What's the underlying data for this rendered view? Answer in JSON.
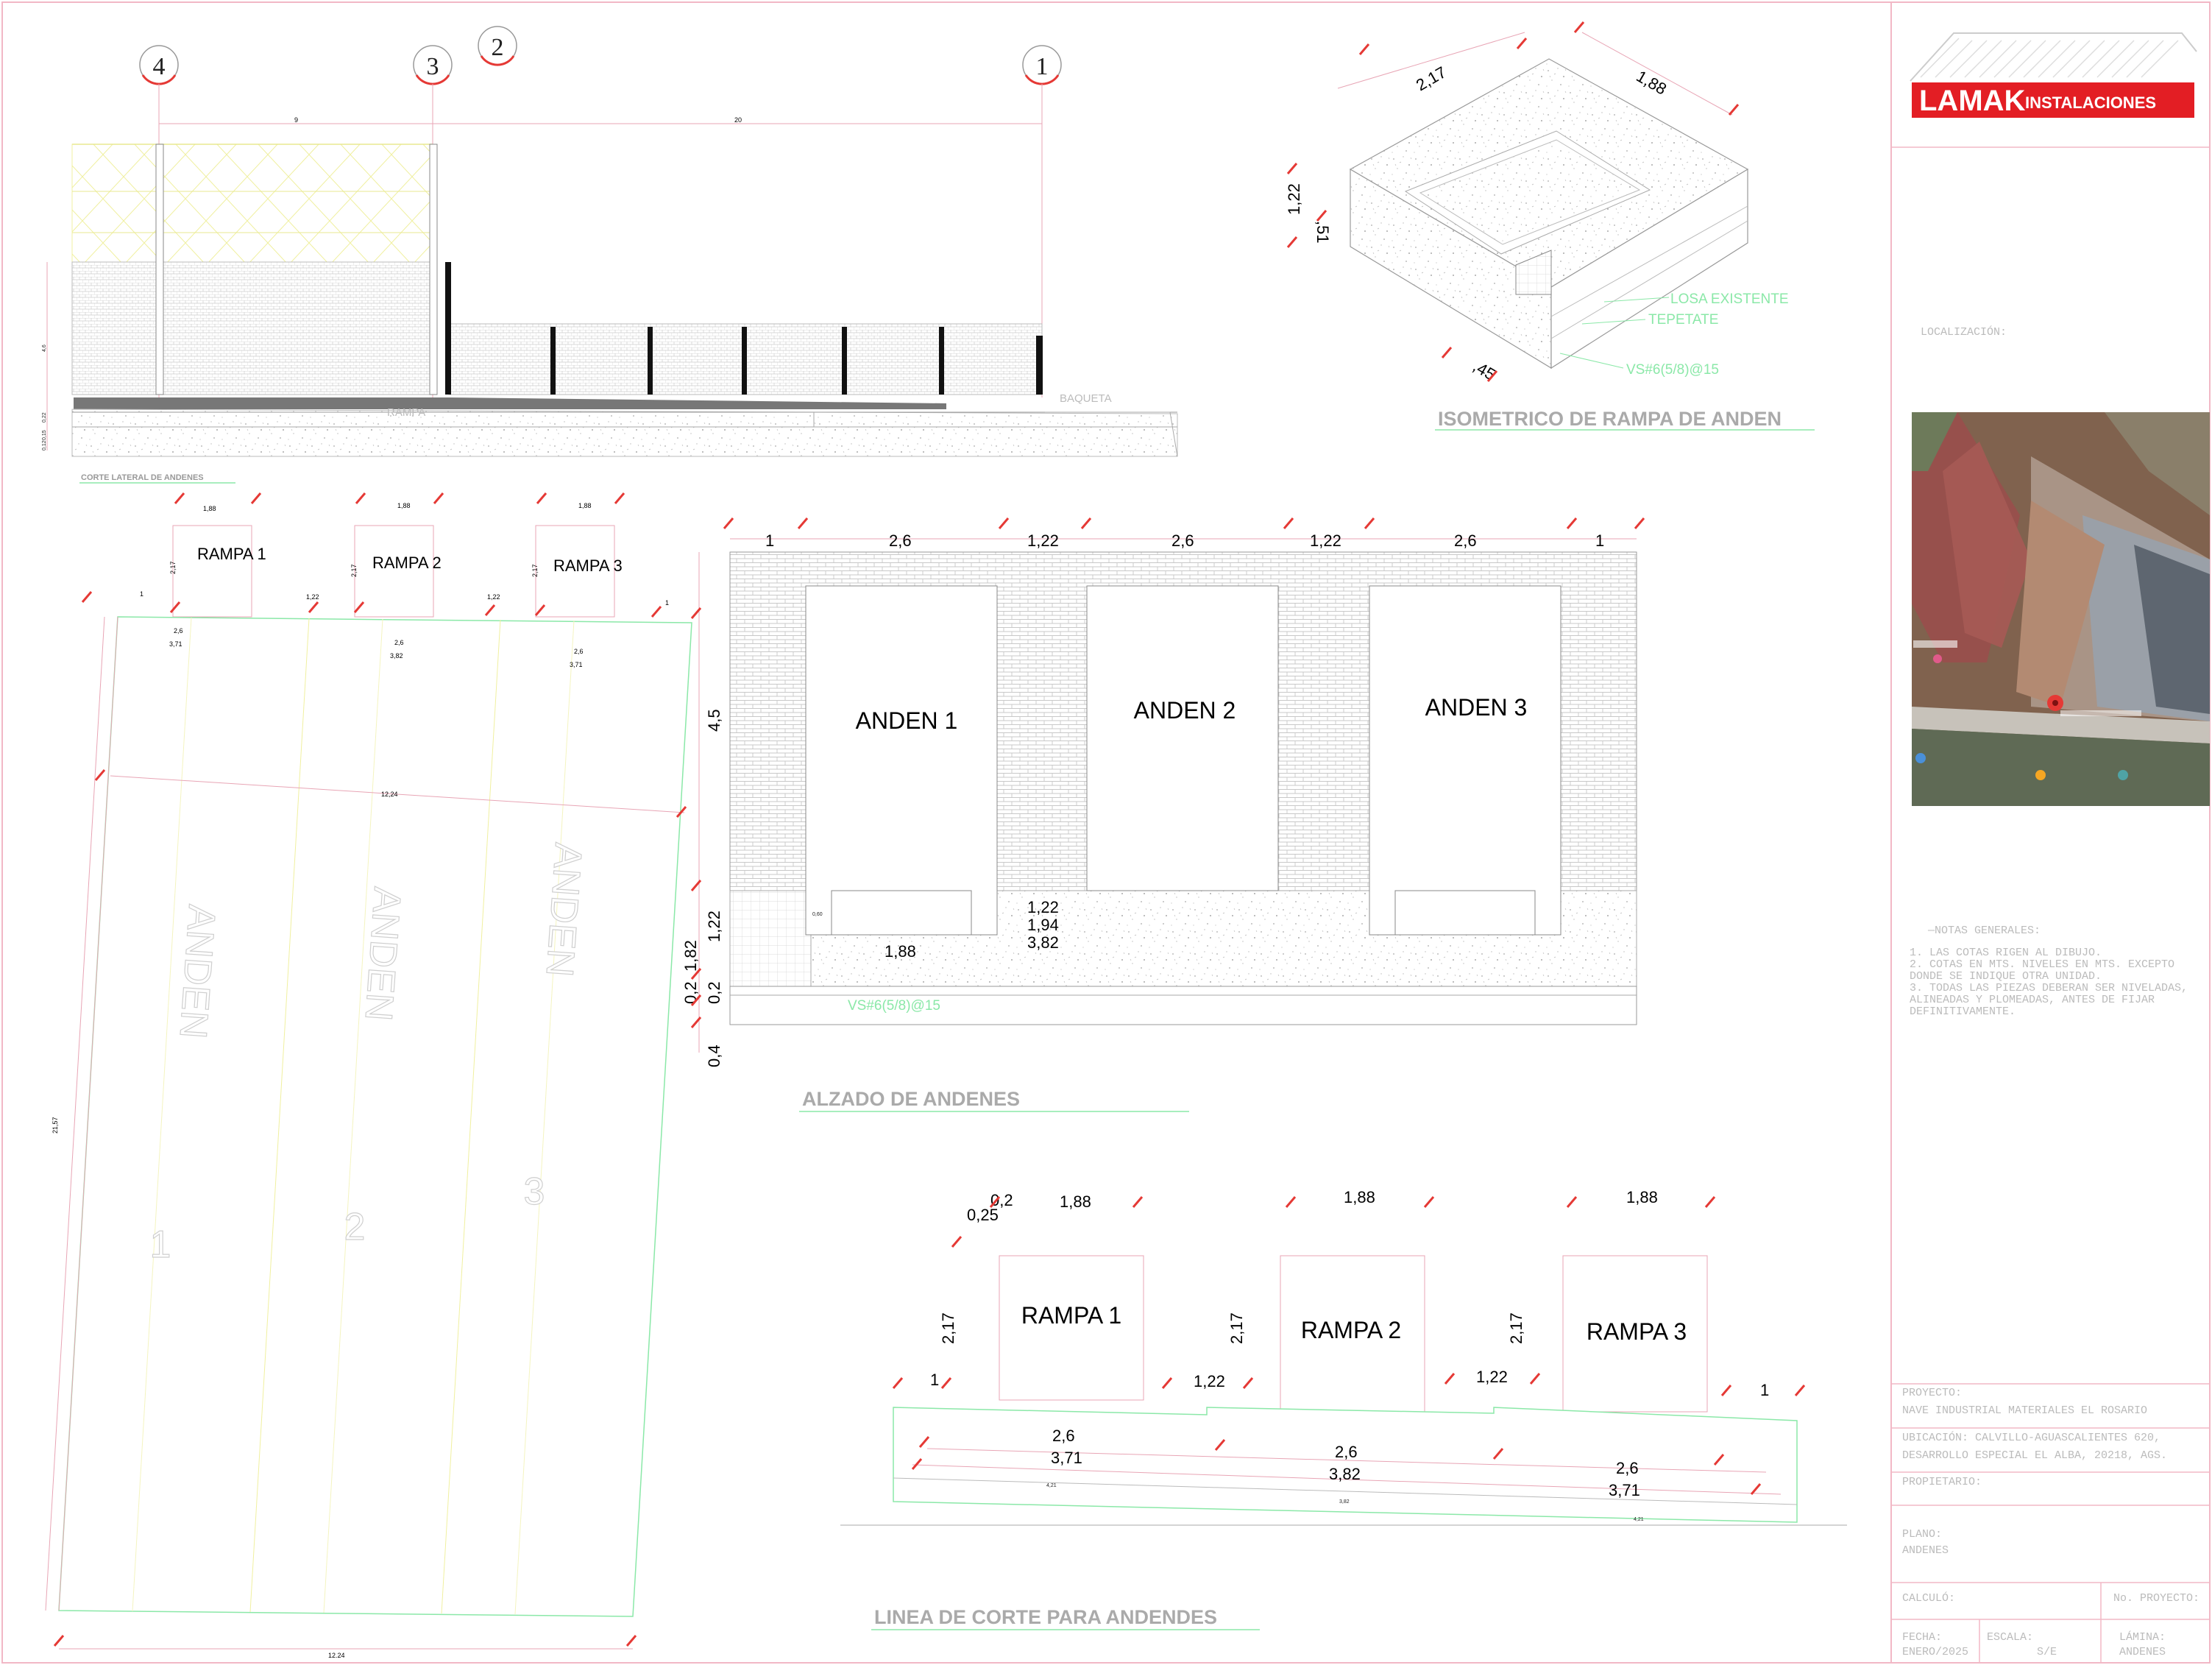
{
  "sheet": {
    "company_logo": {
      "name": "LAMAK",
      "subtitle": "INSTALACIONES",
      "color": "#e31e24"
    },
    "localizacion_label": "LOCALIZACIÓN:",
    "notes": {
      "heading": "—NOTAS GENERALES:",
      "items": [
        "1.  LAS COTAS RIGEN AL DIBUJO.",
        "2.  COTAS EN MTS. NIVELES EN MTS. EXCEPTO",
        "    DONDE SE INDIQUE OTRA UNIDAD.",
        "3.  TODAS LAS PIEZAS DEBERAN SER NIVELADAS,",
        "    ALINEADAS Y PLOMEADAS, ANTES DE FIJAR",
        "    DEFINITIVAMENTE."
      ]
    },
    "title_block": {
      "proyecto_label": "PROYECTO:",
      "proyecto": "NAVE INDUSTRIAL MATERIALES EL ROSARIO",
      "ubicacion_1": "UBICACIÓN: CALVILLO-AGUASCALIENTES 620,",
      "ubicacion_2": "DESARROLLO ESPECIAL EL ALBA, 20218, AGS.",
      "propietario_label": "PROPIETARIO:",
      "plano_label": "PLANO:",
      "plano": "ANDENES",
      "calculo_label": "CALCULÓ:",
      "no_proyecto_label": "No. PROYECTO:",
      "fecha_label": "FECHA:",
      "fecha": "ENERO/2025",
      "escala_label": "ESCALA:",
      "escala": "S/E",
      "lamina_label": "LÁMINA:",
      "lamina": "ANDENES"
    }
  },
  "lateral": {
    "title": "CORTE LATERAL DE ANDENES",
    "grid_labels": [
      "4",
      "3",
      "2",
      "1"
    ],
    "dims_top": [
      "9",
      "20"
    ],
    "left_dims": [
      "4,6",
      "0,22",
      "0,15",
      "0,12"
    ],
    "labels": {
      "rampa": "RAMPA",
      "baqueta": "BAQUETA"
    }
  },
  "iso": {
    "title": "ISOMETRICO DE RAMPA DE ANDEN",
    "dims": [
      "2,17",
      "1,88",
      "1,22",
      ",51",
      ",45"
    ],
    "callouts": [
      "LOSA EXISTENTE",
      "TEPETATE",
      "VS#6(5/8)@15"
    ]
  },
  "plan": {
    "ramps": [
      "RAMPA 1",
      "RAMPA 2",
      "RAMPA 3"
    ],
    "ramp_width": "1,88",
    "ramp_depth": "2,17",
    "gap_small": "1",
    "gap": "1,22",
    "dock_widths": [
      "2,6",
      "2,6",
      "2,6"
    ],
    "bay_widths": [
      "3,71",
      "3,82",
      "3,71"
    ],
    "mid_width": "12,24",
    "length": "21,57",
    "bottom_width": "12.24",
    "docks": [
      {
        "word": "ANDEN",
        "num": "1"
      },
      {
        "word": "ANDEN",
        "num": "2"
      },
      {
        "word": "ANDEN",
        "num": "3"
      }
    ]
  },
  "alzado": {
    "title": "ALZADO DE ANDENES",
    "top_dims": [
      "1",
      "2,6",
      "1,22",
      "2,6",
      "1,22",
      "2,6",
      "1"
    ],
    "openings": [
      "ANDEN 1",
      "ANDEN 2",
      "ANDEN 3"
    ],
    "left_dims": [
      "4,5",
      "1,82",
      "1,22",
      "0,2",
      "0,2",
      "0,4"
    ],
    "inner_dims": [
      "1,22",
      "1,94",
      "3,82",
      "1,88"
    ],
    "small_note": "0,60",
    "rebar": "VS#6(5/8)@15"
  },
  "corte": {
    "title": "LINEA DE CORTE PARA ANDENDES",
    "ramps": [
      "RAMPA 1",
      "RAMPA 2",
      "RAMPA 3"
    ],
    "ramp_width": "1,88",
    "ramp_depth": "2,17",
    "small_dims": [
      "0,2",
      "0,25"
    ],
    "gap_small": "1",
    "gap": "1,22",
    "dock_widths": [
      "2,6",
      "2,6",
      "2,6"
    ],
    "bay_widths": [
      "3,71",
      "3,82",
      "3,71"
    ],
    "bottom_widths": [
      "4,21",
      "3,82",
      "4,21"
    ]
  }
}
